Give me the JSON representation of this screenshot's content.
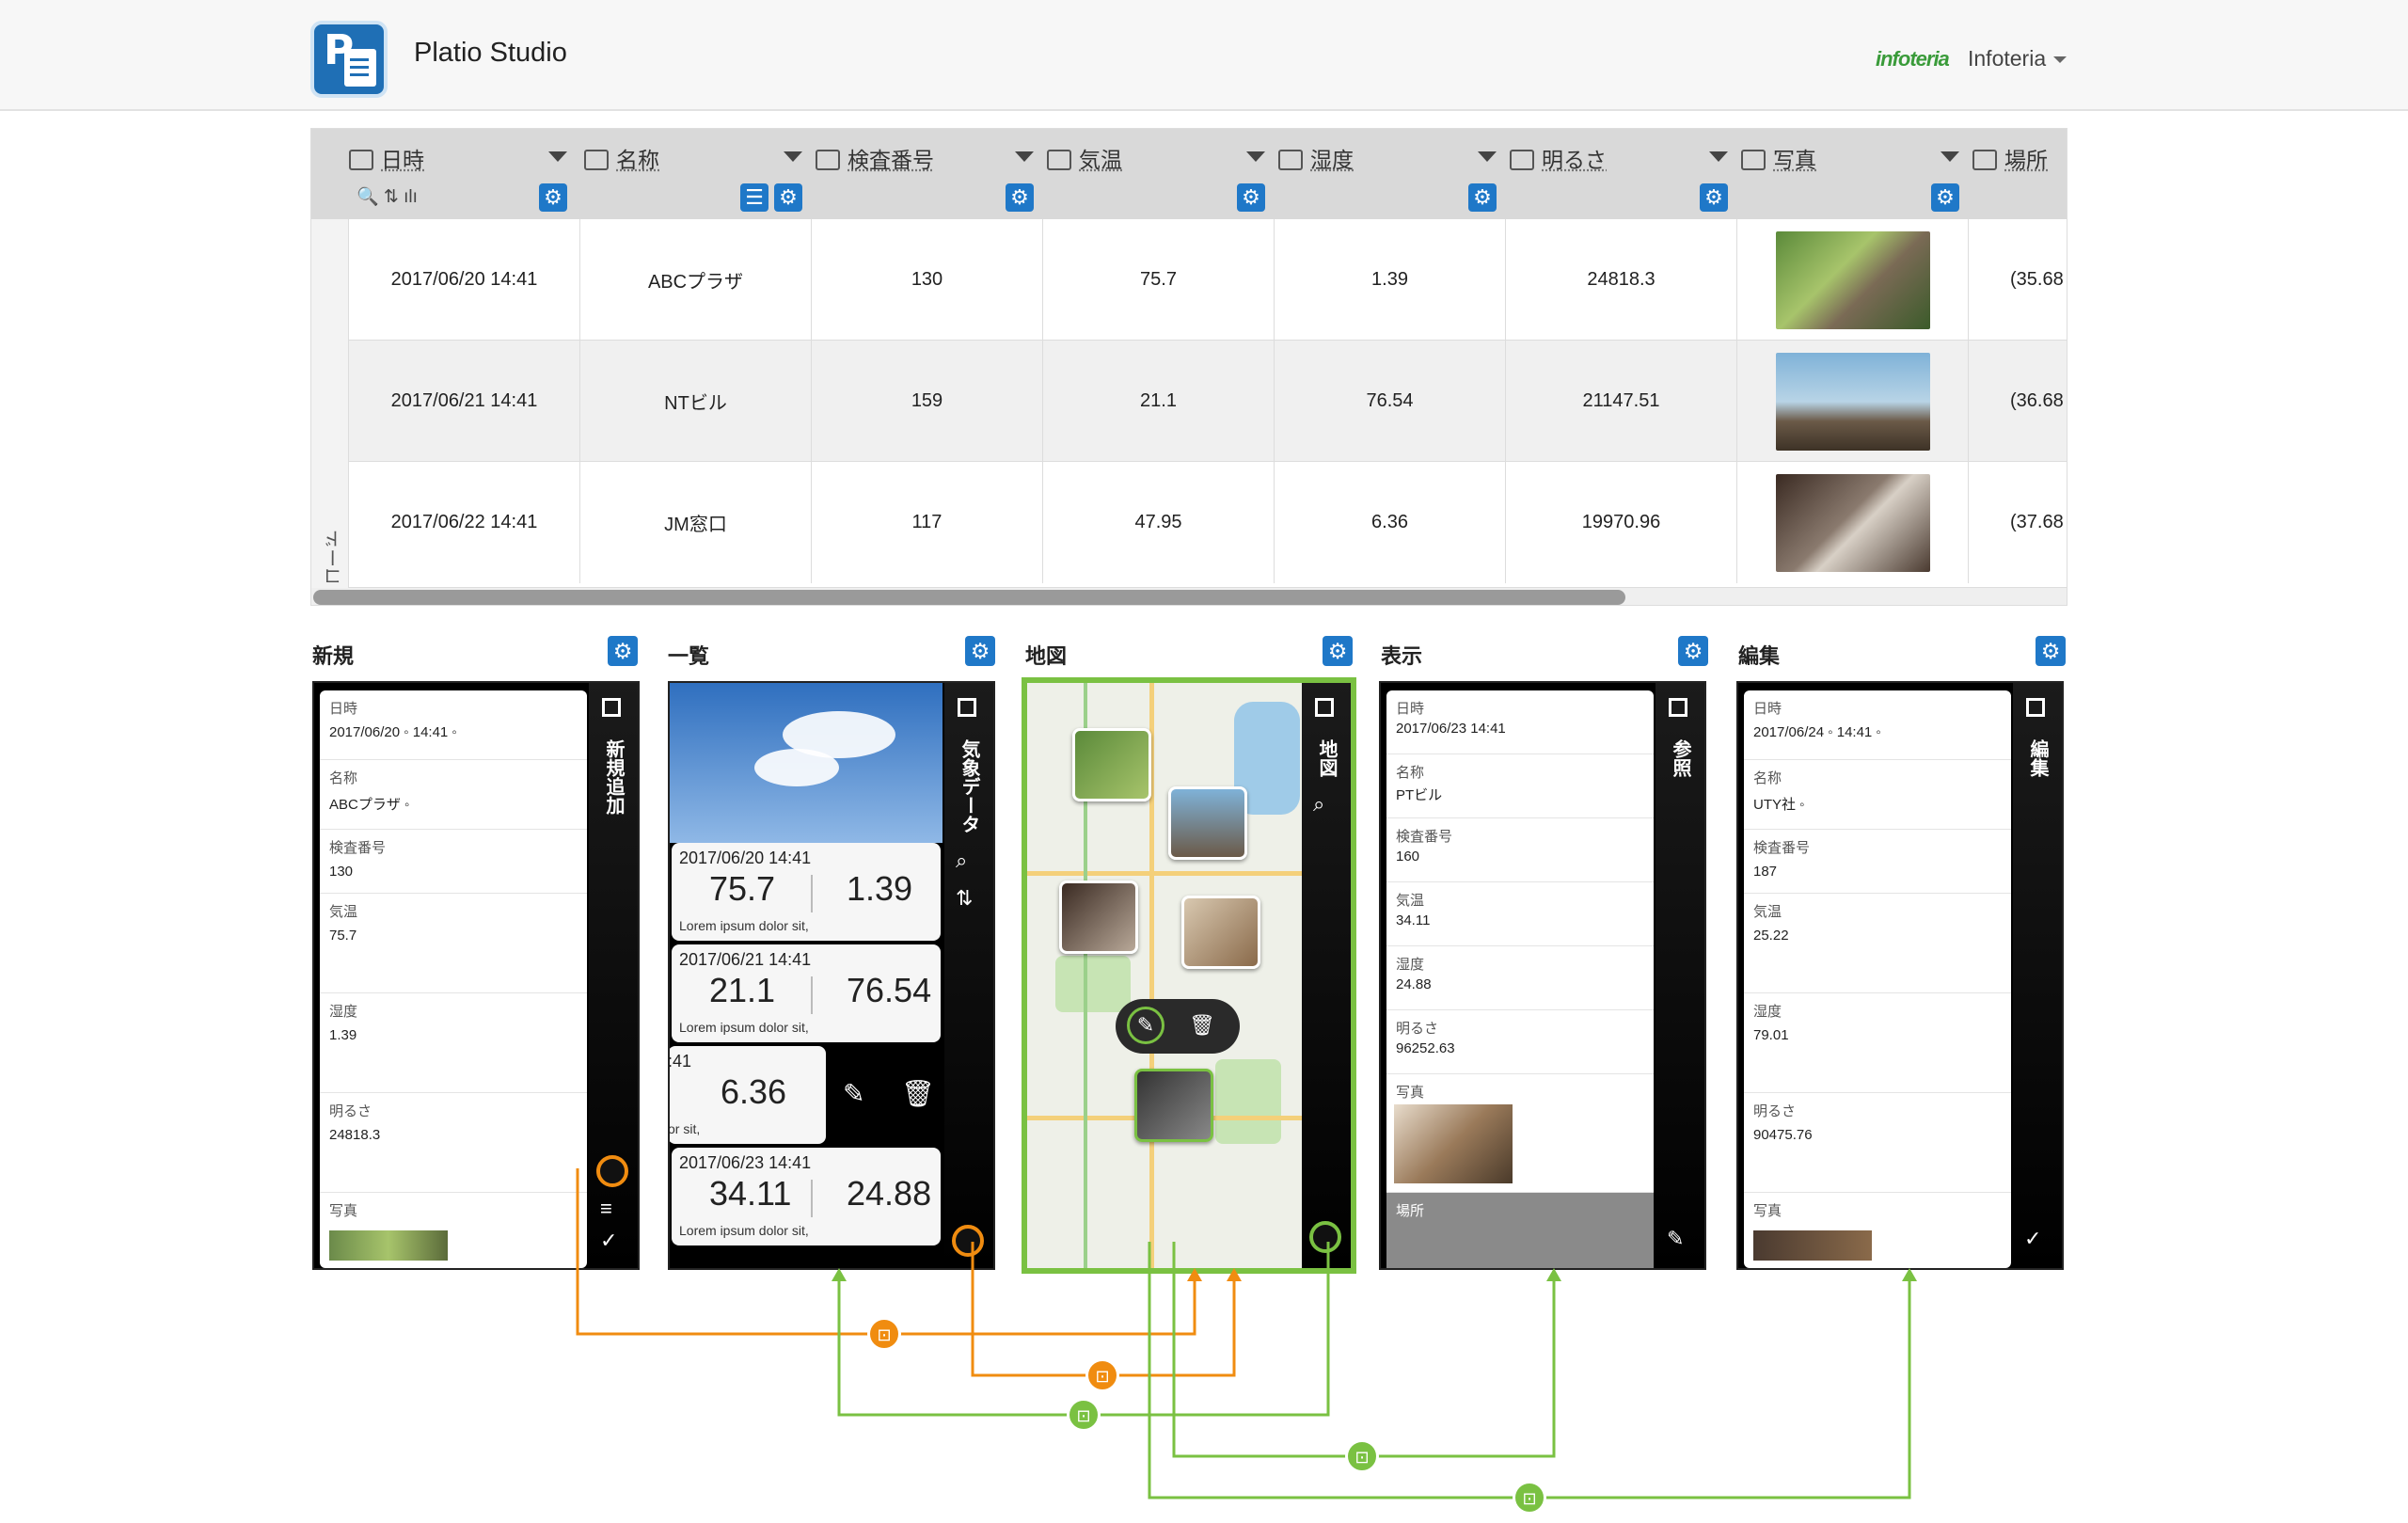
{
  "header": {
    "app_title": "Platio Studio",
    "brand": "infoteria",
    "account": "Infoteria"
  },
  "table": {
    "side_label": "サンプルレコード",
    "columns": [
      "日時",
      "名称",
      "検査番号",
      "気温",
      "湿度",
      "明るさ",
      "写真",
      "場所"
    ],
    "rows": [
      [
        "2017/06/20 14:41",
        "ABCプラザ",
        "130",
        "75.7",
        "1.39",
        "24818.3",
        "",
        "(35.68"
      ],
      [
        "2017/06/21 14:41",
        "NTビル",
        "159",
        "21.1",
        "76.54",
        "21147.51",
        "",
        "(36.68"
      ],
      [
        "2017/06/22 14:41",
        "JM窓口",
        "117",
        "47.95",
        "6.36",
        "19970.96",
        "",
        "(37.68"
      ]
    ]
  },
  "views": {
    "new": {
      "title": "新規",
      "rail_title": "新規追加",
      "fields": [
        {
          "label": "日時",
          "value": "2017/06/20 ◦ 14:41 ◦"
        },
        {
          "label": "名称",
          "value": "ABCプラザ ◦"
        },
        {
          "label": "検査番号",
          "value": "130"
        },
        {
          "label": "気温",
          "value": "75.7"
        },
        {
          "label": "湿度",
          "value": "1.39"
        },
        {
          "label": "明るさ",
          "value": "24818.3"
        },
        {
          "label": "写真",
          "value": ""
        }
      ]
    },
    "list": {
      "title": "一覧",
      "rail_title": "気象データ",
      "cards": [
        {
          "date": "2017/06/20 14:41",
          "v1": "75.7",
          "v2": "1.39",
          "sub": "Lorem ipsum dolor sit,"
        },
        {
          "date": "2017/06/21 14:41",
          "v1": "21.1",
          "v2": "76.54",
          "sub": "Lorem ipsum dolor sit,"
        },
        {
          "date": ":41",
          "v1": "6.36",
          "v2": "",
          "sub": "or sit,"
        },
        {
          "date": "2017/06/23 14:41",
          "v1": "34.11",
          "v2": "24.88",
          "sub": "Lorem ipsum dolor sit,"
        }
      ]
    },
    "map": {
      "title": "地図",
      "rail_title": "地図"
    },
    "show": {
      "title": "表示",
      "rail_title": "参照",
      "fields": [
        {
          "label": "日時",
          "value": "2017/06/23 14:41"
        },
        {
          "label": "名称",
          "value": "PTビル"
        },
        {
          "label": "検査番号",
          "value": "160"
        },
        {
          "label": "気温",
          "value": "34.11"
        },
        {
          "label": "湿度",
          "value": "24.88"
        },
        {
          "label": "明るさ",
          "value": "96252.63"
        },
        {
          "label": "写真",
          "value": ""
        },
        {
          "label": "場所",
          "value": ""
        }
      ]
    },
    "edit": {
      "title": "編集",
      "rail_title": "編集",
      "fields": [
        {
          "label": "日時",
          "value": "2017/06/24 ◦ 14:41 ◦"
        },
        {
          "label": "名称",
          "value": "UTY社 ◦"
        },
        {
          "label": "検査番号",
          "value": "187"
        },
        {
          "label": "気温",
          "value": "25.22"
        },
        {
          "label": "湿度",
          "value": "79.01"
        },
        {
          "label": "明るさ",
          "value": "90475.76"
        },
        {
          "label": "写真",
          "value": ""
        }
      ]
    }
  },
  "colors": {
    "accent": "#1f78c8",
    "orange": "#f08c10",
    "green": "#7ac142"
  }
}
